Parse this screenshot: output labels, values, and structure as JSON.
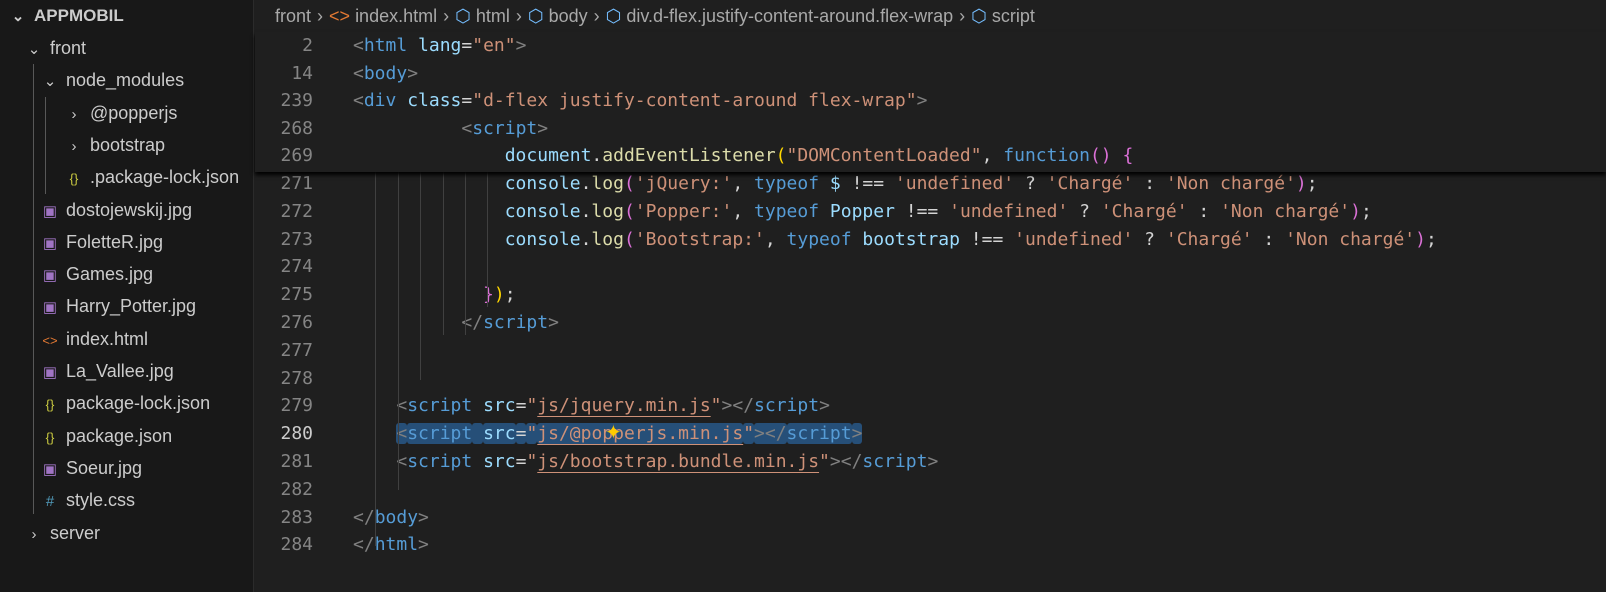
{
  "explorer": {
    "root": "APPMOBIL",
    "items": [
      {
        "label": "front",
        "kind": "folder-open",
        "depth": 1
      },
      {
        "label": "node_modules",
        "kind": "folder-open",
        "depth": 2
      },
      {
        "label": "@popperjs",
        "kind": "folder",
        "depth": 3
      },
      {
        "label": "bootstrap",
        "kind": "folder",
        "depth": 3
      },
      {
        "label": ".package-lock.json",
        "kind": "json",
        "depth": 3
      },
      {
        "label": "dostojewskij.jpg",
        "kind": "image",
        "depth": 2
      },
      {
        "label": "FoletteR.jpg",
        "kind": "image",
        "depth": 2
      },
      {
        "label": "Games.jpg",
        "kind": "image",
        "depth": 2
      },
      {
        "label": "Harry_Potter.jpg",
        "kind": "image",
        "depth": 2
      },
      {
        "label": "index.html",
        "kind": "html",
        "depth": 2
      },
      {
        "label": "La_Vallee.jpg",
        "kind": "image",
        "depth": 2
      },
      {
        "label": "package-lock.json",
        "kind": "json",
        "depth": 2
      },
      {
        "label": "package.json",
        "kind": "json",
        "depth": 2
      },
      {
        "label": "Soeur.jpg",
        "kind": "image",
        "depth": 2
      },
      {
        "label": "style.css",
        "kind": "css",
        "depth": 2
      },
      {
        "label": "server",
        "kind": "folder",
        "depth": 1
      }
    ]
  },
  "breadcrumb": [
    "front",
    "index.html",
    "html",
    "body",
    "div.d-flex.justify-content-around.flex-wrap",
    "script"
  ],
  "colors": {
    "tag": "#569cd6",
    "attr": "#9cdcfe",
    "string": "#ce9178",
    "selection": "#264f78",
    "sparkle": "#ffcc00"
  },
  "sticky_lines": [
    {
      "n": "2",
      "tokens": [
        [
          "p",
          "<"
        ],
        [
          "t",
          "html"
        ],
        [
          "d",
          " "
        ],
        [
          "a",
          "lang"
        ],
        [
          "d",
          "="
        ],
        [
          "s",
          "\"en\""
        ],
        [
          "p",
          ">"
        ]
      ]
    },
    {
      "n": "14",
      "tokens": [
        [
          "p",
          "<"
        ],
        [
          "t",
          "body"
        ],
        [
          "p",
          ">"
        ]
      ]
    },
    {
      "n": "239",
      "tokens": [
        [
          "p",
          "<"
        ],
        [
          "t",
          "div"
        ],
        [
          "d",
          " "
        ],
        [
          "a",
          "class"
        ],
        [
          "d",
          "="
        ],
        [
          "s",
          "\"d-flex justify-content-around flex-wrap\""
        ],
        [
          "p",
          ">"
        ]
      ]
    },
    {
      "n": "268",
      "tokens": [
        [
          "d",
          "          "
        ],
        [
          "p",
          "<"
        ],
        [
          "t",
          "script"
        ],
        [
          "p",
          ">"
        ]
      ]
    },
    {
      "n": "269",
      "tokens": [
        [
          "d",
          "              "
        ],
        [
          "v",
          "document"
        ],
        [
          "d",
          "."
        ],
        [
          "f",
          "addEventListener"
        ],
        [
          "y",
          "("
        ],
        [
          "s",
          "\"DOMContentLoaded\""
        ],
        [
          "d",
          ", "
        ],
        [
          "k",
          "function"
        ],
        [
          "m",
          "()"
        ],
        [
          "d",
          " "
        ],
        [
          "m",
          "{"
        ]
      ]
    }
  ],
  "lines": [
    {
      "n": "271",
      "tokens": [
        [
          "d",
          "              "
        ],
        [
          "v",
          "console"
        ],
        [
          "d",
          "."
        ],
        [
          "f",
          "log"
        ],
        [
          "m",
          "("
        ],
        [
          "s",
          "'jQuery:'"
        ],
        [
          "d",
          ", "
        ],
        [
          "k",
          "typeof"
        ],
        [
          "d",
          " "
        ],
        [
          "v",
          "$"
        ],
        [
          "d",
          " !== "
        ],
        [
          "s",
          "'undefined'"
        ],
        [
          "d",
          " ? "
        ],
        [
          "s",
          "'Chargé'"
        ],
        [
          "d",
          " : "
        ],
        [
          "s",
          "'Non chargé'"
        ],
        [
          "m",
          ")"
        ],
        [
          "d",
          ";"
        ]
      ]
    },
    {
      "n": "272",
      "tokens": [
        [
          "d",
          "              "
        ],
        [
          "v",
          "console"
        ],
        [
          "d",
          "."
        ],
        [
          "f",
          "log"
        ],
        [
          "m",
          "("
        ],
        [
          "s",
          "'Popper:'"
        ],
        [
          "d",
          ", "
        ],
        [
          "k",
          "typeof"
        ],
        [
          "d",
          " "
        ],
        [
          "v",
          "Popper"
        ],
        [
          "d",
          " !== "
        ],
        [
          "s",
          "'undefined'"
        ],
        [
          "d",
          " ? "
        ],
        [
          "s",
          "'Chargé'"
        ],
        [
          "d",
          " : "
        ],
        [
          "s",
          "'Non chargé'"
        ],
        [
          "m",
          ")"
        ],
        [
          "d",
          ";"
        ]
      ]
    },
    {
      "n": "273",
      "tokens": [
        [
          "d",
          "              "
        ],
        [
          "v",
          "console"
        ],
        [
          "d",
          "."
        ],
        [
          "f",
          "log"
        ],
        [
          "m",
          "("
        ],
        [
          "s",
          "'Bootstrap:'"
        ],
        [
          "d",
          ", "
        ],
        [
          "k",
          "typeof"
        ],
        [
          "d",
          " "
        ],
        [
          "v",
          "bootstrap"
        ],
        [
          "d",
          " !== "
        ],
        [
          "s",
          "'undefined'"
        ],
        [
          "d",
          " ? "
        ],
        [
          "s",
          "'Chargé'"
        ],
        [
          "d",
          " : "
        ],
        [
          "s",
          "'Non chargé'"
        ],
        [
          "m",
          ")"
        ],
        [
          "d",
          ";"
        ]
      ]
    },
    {
      "n": "274",
      "tokens": []
    },
    {
      "n": "275",
      "tokens": [
        [
          "d",
          "            "
        ],
        [
          "m",
          "}"
        ],
        [
          "y",
          ")"
        ],
        [
          "d",
          ";"
        ]
      ]
    },
    {
      "n": "276",
      "tokens": [
        [
          "d",
          "          "
        ],
        [
          "p",
          "</"
        ],
        [
          "t",
          "script"
        ],
        [
          "p",
          ">"
        ]
      ]
    },
    {
      "n": "277",
      "tokens": []
    },
    {
      "n": "278",
      "tokens": []
    },
    {
      "n": "279",
      "tokens": [
        [
          "d",
          "    "
        ],
        [
          "p",
          "<"
        ],
        [
          "t",
          "script"
        ],
        [
          "d",
          " "
        ],
        [
          "a",
          "src"
        ],
        [
          "d",
          "="
        ],
        [
          "s",
          "\""
        ],
        [
          "s u",
          "js/jquery.min.js"
        ],
        [
          "s",
          "\""
        ],
        [
          "p",
          "></"
        ],
        [
          "t",
          "script"
        ],
        [
          "p",
          ">"
        ]
      ]
    },
    {
      "n": "280",
      "current": true,
      "tokens": [
        [
          "d",
          "    "
        ],
        [
          "p hl",
          "<"
        ],
        [
          "t hl",
          "script"
        ],
        [
          "d hl",
          " "
        ],
        [
          "a hl",
          "src"
        ],
        [
          "d hl",
          "="
        ],
        [
          "s hl",
          "\""
        ],
        [
          "s u hl",
          "js/@popperjs.min.js"
        ],
        [
          "s hl",
          "\""
        ],
        [
          "p hl",
          "></"
        ],
        [
          "t hl",
          "script"
        ],
        [
          "p hl",
          ">"
        ]
      ]
    },
    {
      "n": "281",
      "tokens": [
        [
          "d",
          "    "
        ],
        [
          "p",
          "<"
        ],
        [
          "t",
          "script"
        ],
        [
          "d",
          " "
        ],
        [
          "a",
          "src"
        ],
        [
          "d",
          "="
        ],
        [
          "s",
          "\""
        ],
        [
          "s u",
          "js/bootstrap.bundle.min.js"
        ],
        [
          "s",
          "\""
        ],
        [
          "p",
          "></"
        ],
        [
          "t",
          "script"
        ],
        [
          "p",
          ">"
        ]
      ]
    },
    {
      "n": "282",
      "tokens": []
    },
    {
      "n": "283",
      "tokens": [
        [
          "p",
          "</"
        ],
        [
          "t",
          "body"
        ],
        [
          "p",
          ">"
        ]
      ]
    },
    {
      "n": "284",
      "tokens": [
        [
          "p",
          "</"
        ],
        [
          "t",
          "html"
        ],
        [
          "p",
          ">"
        ]
      ]
    }
  ]
}
